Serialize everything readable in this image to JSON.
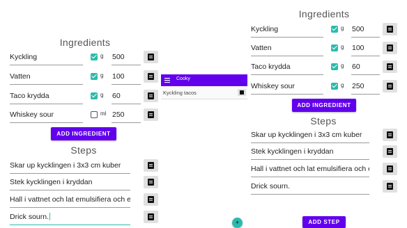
{
  "left": {
    "ingredients_heading": "Ingredients",
    "ingredients": [
      {
        "name": "Kyckling",
        "checked": true,
        "unit": "g",
        "amount": "500"
      },
      {
        "name": "Vatten",
        "checked": true,
        "unit": "g",
        "amount": "100"
      },
      {
        "name": "Taco krydda",
        "checked": true,
        "unit": "g",
        "amount": "60"
      },
      {
        "name": "Whiskey sour",
        "checked": false,
        "unit": "ml",
        "amount": "250"
      }
    ],
    "add_ingredient_label": "ADD INGREDIENT",
    "steps_heading": "Steps",
    "steps": [
      "Skar up kycklingen i 3x3 cm kuber",
      "Stek kycklingen i kryddan",
      "Hall i vattnet och lat emulsifiera och e",
      "Drick sourn."
    ]
  },
  "middle": {
    "app_title": "Cooky",
    "recipe_name": "Kyckling tacos",
    "fab_label": "+"
  },
  "right": {
    "ingredients_heading": "Ingredients",
    "ingredients": [
      {
        "name": "Kyckling",
        "checked": true,
        "unit": "g",
        "amount": "500"
      },
      {
        "name": "Vatten",
        "checked": true,
        "unit": "g",
        "amount": "100"
      },
      {
        "name": "Taco krydda",
        "checked": true,
        "unit": "g",
        "amount": "60"
      },
      {
        "name": "Whiskey sour",
        "checked": true,
        "unit": "g",
        "amount": "250"
      }
    ],
    "add_ingredient_label": "ADD INGREDIENT",
    "steps_heading": "Steps",
    "steps": [
      "Skar up kycklingen i 3x3 cm kuber",
      "Stek kycklingen i kryddan",
      "Hall i vattnet och lat emulsifiera och e",
      "Drick sourn."
    ],
    "add_step_label": "ADD STEP"
  },
  "colors": {
    "primary": "#6200ee",
    "accent": "#2bbbad",
    "delete_bg": "#e0e0e0"
  }
}
